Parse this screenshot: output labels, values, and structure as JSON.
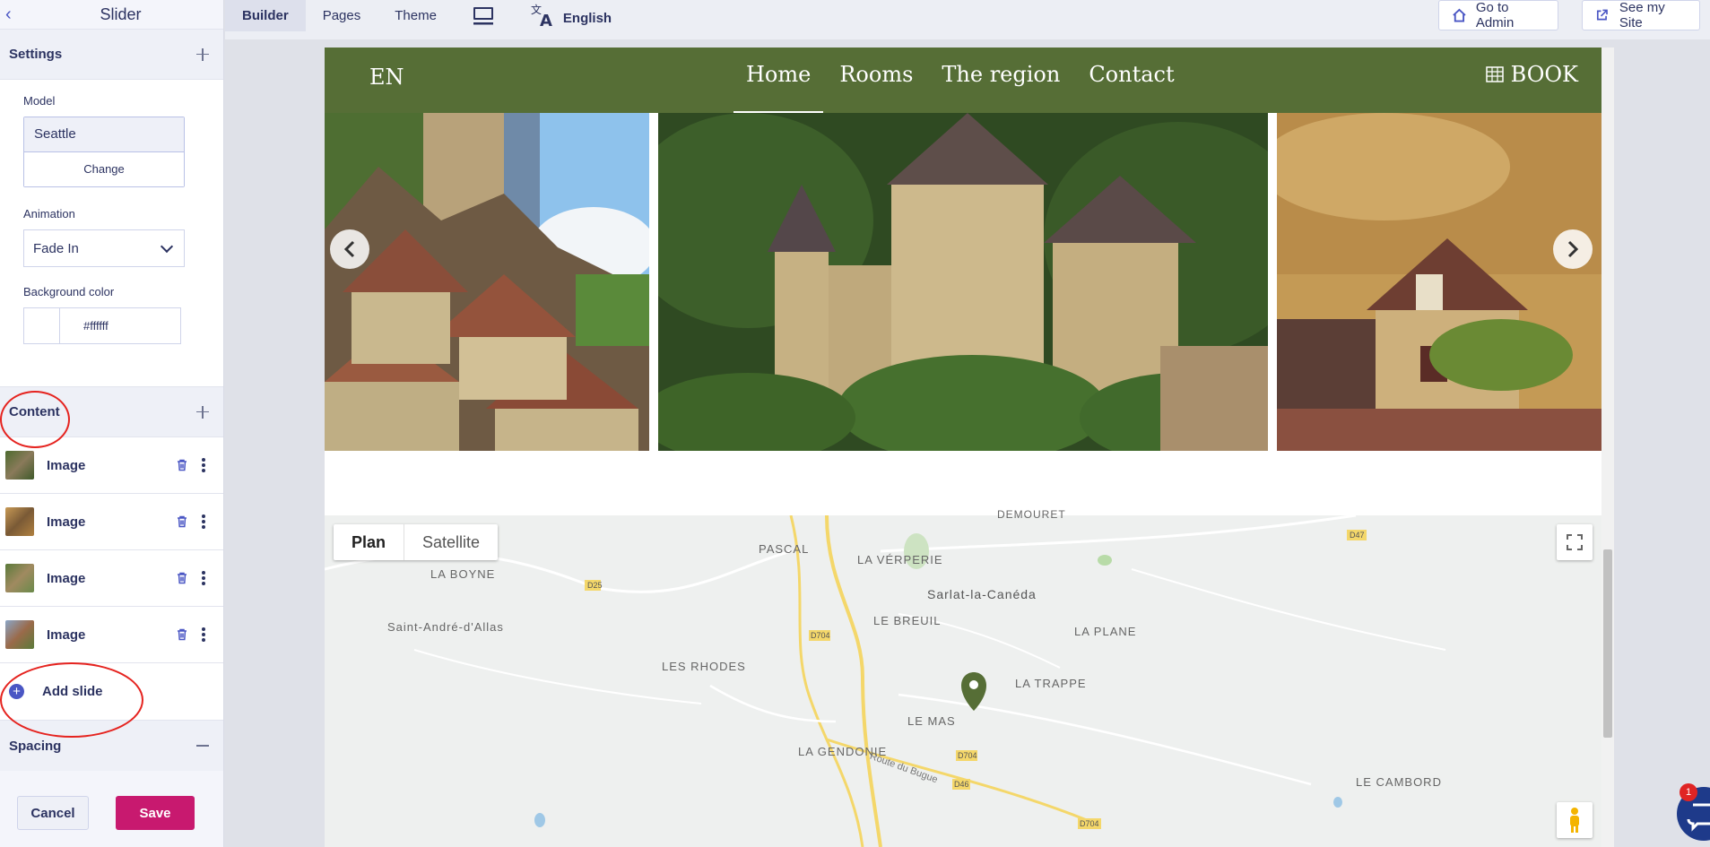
{
  "panel": {
    "title": "Slider",
    "settings": {
      "heading": "Settings",
      "model_label": "Model",
      "model_value": "Seattle",
      "change_label": "Change",
      "animation_label": "Animation",
      "animation_value": "Fade In",
      "bg_label": "Background color",
      "bg_value": "#ffffff"
    },
    "content": {
      "heading": "Content",
      "slides": [
        {
          "label": "Image"
        },
        {
          "label": "Image"
        },
        {
          "label": "Image"
        },
        {
          "label": "Image"
        }
      ],
      "add_label": "Add slide"
    },
    "spacing_heading": "Spacing",
    "cancel_label": "Cancel",
    "save_label": "Save"
  },
  "topbar": {
    "tabs": [
      "Builder",
      "Pages",
      "Theme"
    ],
    "language": "English",
    "admin_label": "Go to Admin",
    "site_label": "See my Site"
  },
  "site": {
    "lang": "EN",
    "nav": [
      "Home",
      "Rooms",
      "The region",
      "Contact"
    ],
    "book_label": "BOOK",
    "brand_color": "#566e36"
  },
  "map": {
    "plan_label": "Plan",
    "satellite_label": "Satellite",
    "places": [
      {
        "name": "DEMOURET"
      },
      {
        "name": "PASCAL"
      },
      {
        "name": "LA VÉRPERIE"
      },
      {
        "name": "LA BOYNE"
      },
      {
        "name": "Sarlat-la-Canéda"
      },
      {
        "name": "LE BREUIL"
      },
      {
        "name": "LA PLANE"
      },
      {
        "name": "Saint-André-d'Allas"
      },
      {
        "name": "LES RHODES"
      },
      {
        "name": "LA TRAPPE"
      },
      {
        "name": "LE MAS"
      },
      {
        "name": "LA GENDONIE"
      },
      {
        "name": "LE CAMBORD"
      },
      {
        "name": "Route du Bugue"
      }
    ],
    "road_labels": [
      "D25",
      "D704",
      "D47",
      "D704",
      "D46",
      "D704"
    ]
  },
  "chat_badge": "1"
}
